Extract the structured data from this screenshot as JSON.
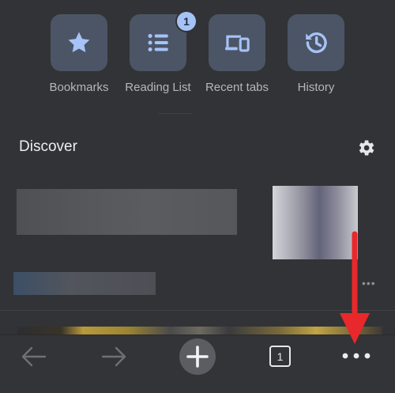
{
  "shortcuts": [
    {
      "label": "Bookmarks",
      "icon": "star-icon"
    },
    {
      "label": "Reading List",
      "icon": "list-icon",
      "badge": "1"
    },
    {
      "label": "Recent tabs",
      "icon": "devices-icon"
    },
    {
      "label": "History",
      "icon": "history-icon"
    }
  ],
  "discover": {
    "title": "Discover",
    "settings_icon": "gear-icon",
    "card_menu": "•••"
  },
  "toolbar": {
    "back_icon": "back-arrow-icon",
    "forward_icon": "forward-arrow-icon",
    "new_tab_icon": "plus-icon",
    "tab_count": "1",
    "more_icon": "more-dots-icon"
  },
  "colors": {
    "background": "#323336",
    "tile": "#4b5566",
    "icon_accent": "#a6c3f7",
    "annotation_arrow": "#e8282b"
  }
}
